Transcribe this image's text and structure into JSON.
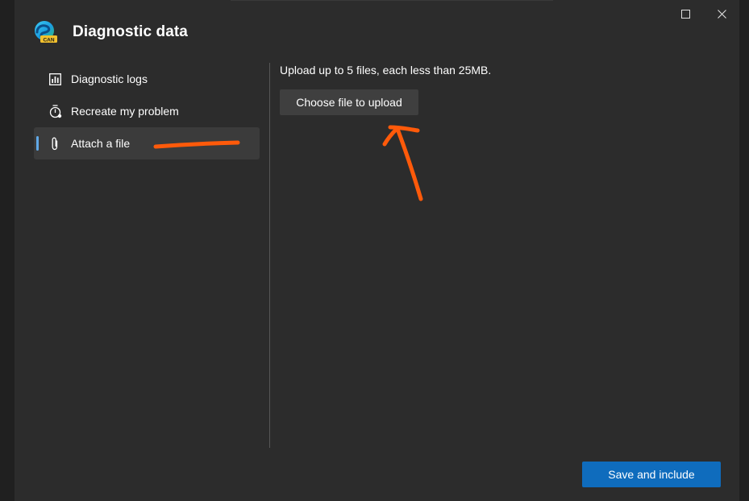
{
  "window": {
    "title": "Diagnostic data",
    "logo_badge": "CAN",
    "maximize_icon": "maximize-icon",
    "close_icon": "close-icon"
  },
  "sidebar": {
    "items": [
      {
        "label": "Diagnostic logs",
        "icon": "bar-chart-icon",
        "selected": false
      },
      {
        "label": "Recreate my problem",
        "icon": "timer-icon",
        "selected": false
      },
      {
        "label": "Attach a file",
        "icon": "paperclip-icon",
        "selected": true
      }
    ]
  },
  "content": {
    "upload_instruction": "Upload up to 5 files, each less than 25MB.",
    "choose_button_label": "Choose file to upload"
  },
  "footer": {
    "save_button_label": "Save and include"
  },
  "colors": {
    "background": "#2c2c2c",
    "selected_item": "#3b3b3b",
    "accent": "#60a8e6",
    "primary_button": "#0f6cbd",
    "annotation": "#ff5a0a"
  }
}
